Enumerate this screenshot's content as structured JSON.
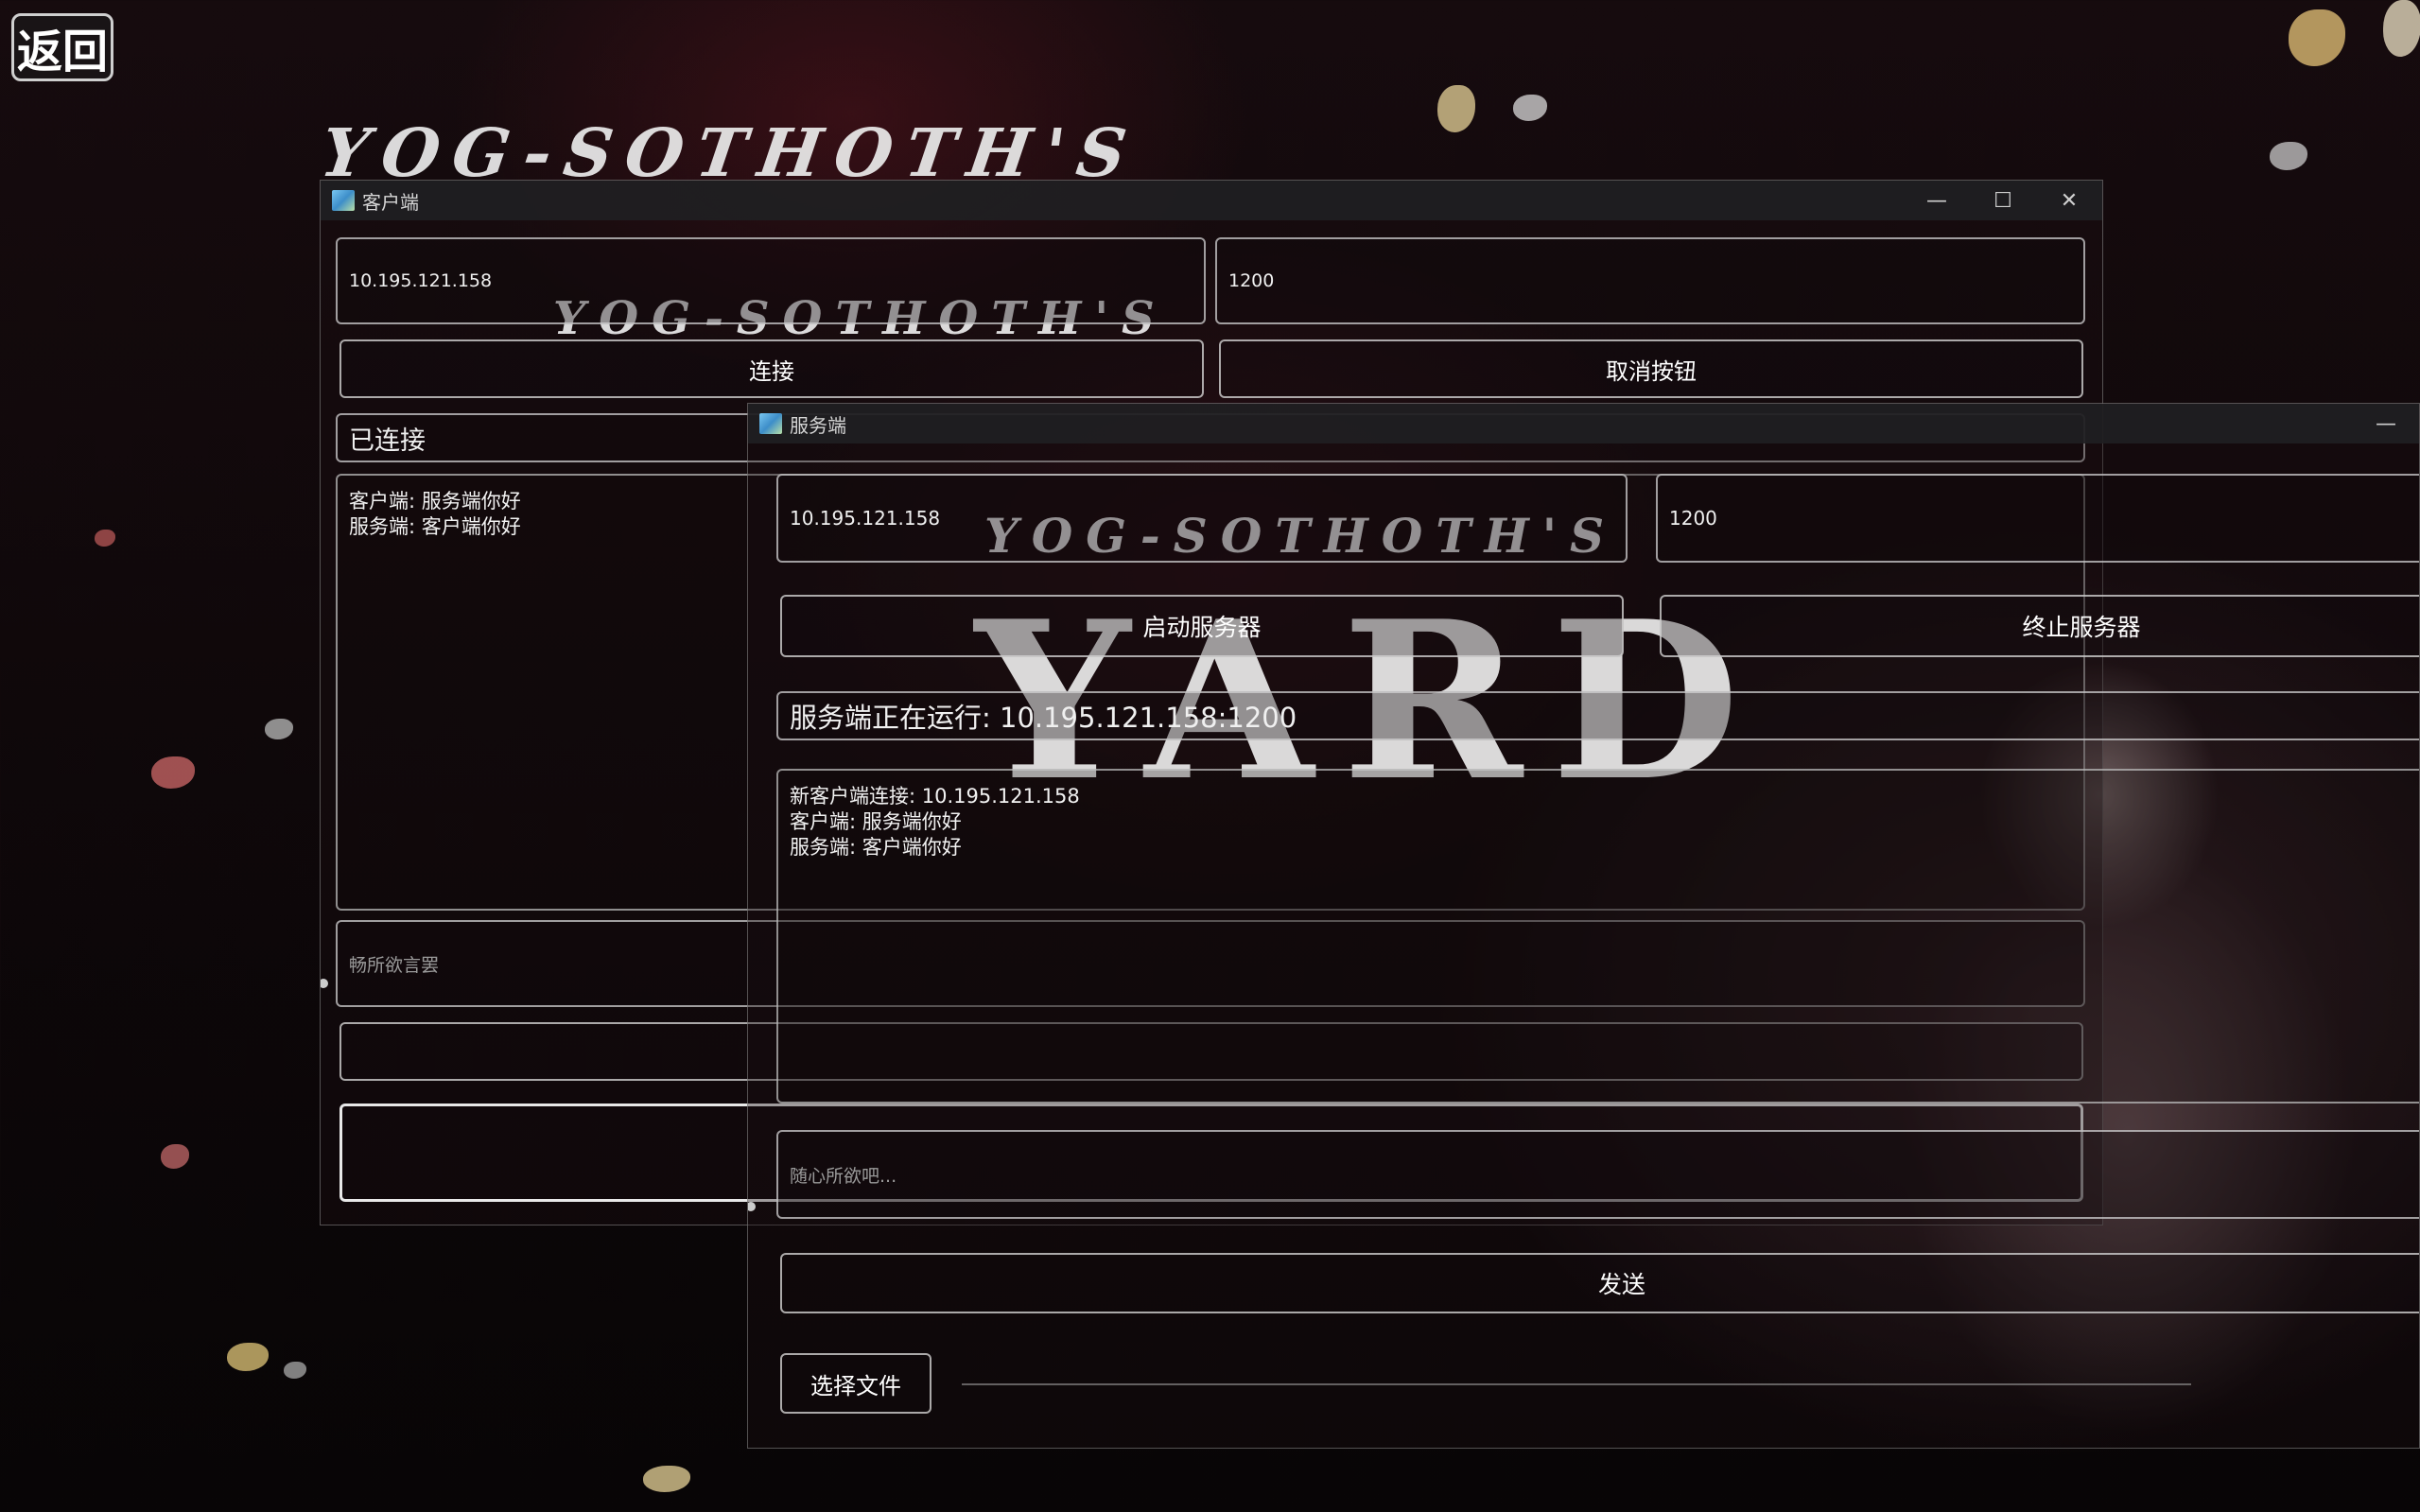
{
  "app": {
    "back_label": "返回",
    "logo_line": "YOG-SOTHOTH'S",
    "logo_big": "YARD"
  },
  "client_window": {
    "title": "客户端",
    "controls": {
      "minimize": "—",
      "maximize": "☐",
      "close": "✕"
    },
    "ip_value": "10.195.121.158",
    "port_value": "1200",
    "connect_label": "连接",
    "cancel_label": "取消按钮",
    "status": "已连接",
    "log_lines": [
      "客户端: 服务端你好",
      "服务端: 客户端你好"
    ],
    "message_placeholder": "畅所欲言罢"
  },
  "server_window": {
    "title": "服务端",
    "controls": {
      "minimize": "—"
    },
    "ip_value": "10.195.121.158",
    "port_value": "1200",
    "start_label": "启动服务器",
    "stop_label": "终止服务器",
    "status": "服务端正在运行: 10.195.121.158:1200",
    "log_lines": [
      "新客户端连接: 10.195.121.158",
      "客户端: 服务端你好",
      "服务端: 客户端你好"
    ],
    "message_placeholder": "随心所欲吧...",
    "send_label": "发送",
    "select_file_label": "选择文件"
  },
  "colors": {
    "accent_border": "#d2d2d2",
    "titlebar": "#202022",
    "background": "#0d0709"
  }
}
